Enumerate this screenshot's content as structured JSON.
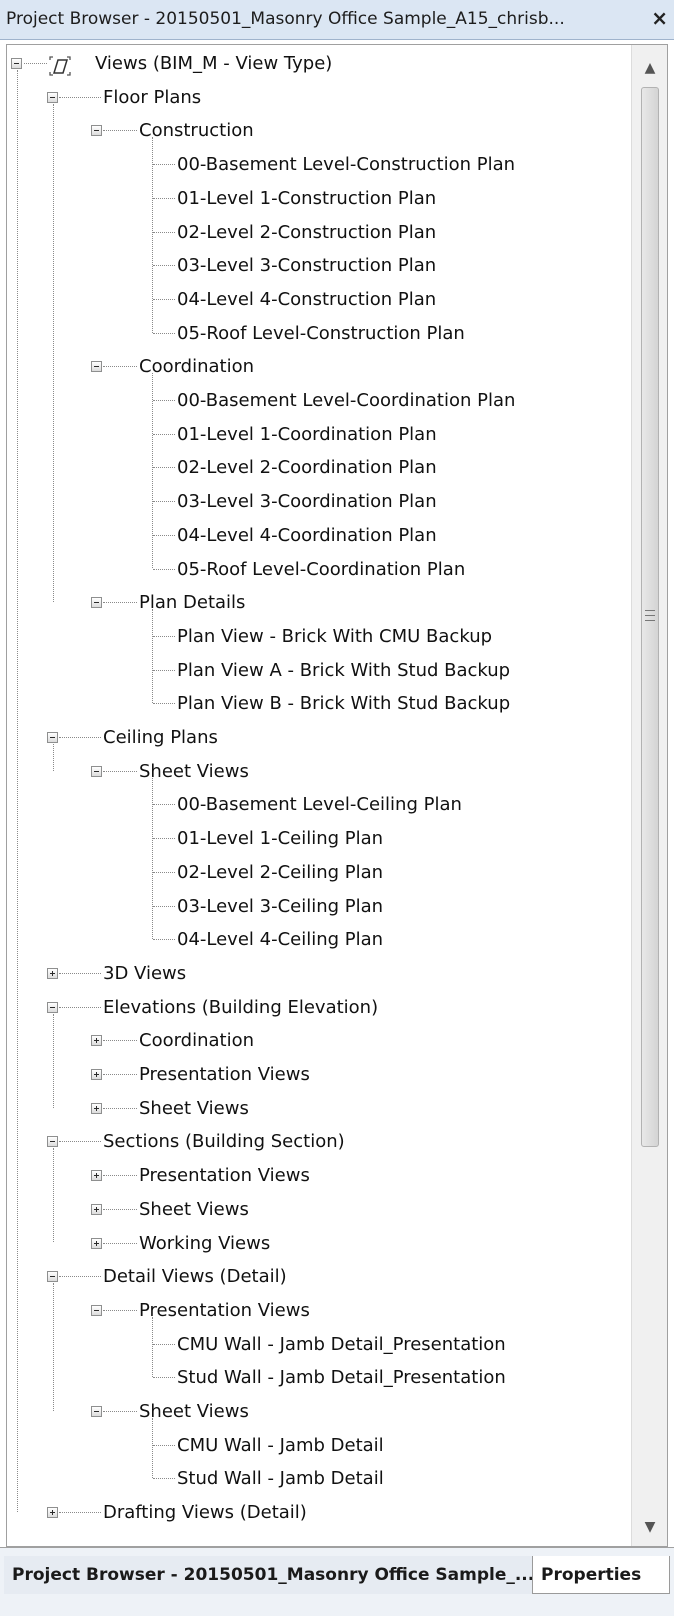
{
  "title_bar": {
    "title": "Project Browser - 20150501_Masonry Office Sample_A15_chrisb...",
    "close_label": "×"
  },
  "tree": {
    "items": [
      {
        "label": "Views (BIM_M - View Type)",
        "level": 0,
        "state": "expanded",
        "root": true
      },
      {
        "label": "Floor Plans",
        "level": 1,
        "state": "expanded"
      },
      {
        "label": "Construction",
        "level": 2,
        "state": "expanded"
      },
      {
        "label": "00-Basement Level-Construction Plan",
        "level": 3,
        "state": "leaf"
      },
      {
        "label": "01-Level 1-Construction Plan",
        "level": 3,
        "state": "leaf"
      },
      {
        "label": "02-Level 2-Construction Plan",
        "level": 3,
        "state": "leaf"
      },
      {
        "label": "03-Level 3-Construction Plan",
        "level": 3,
        "state": "leaf"
      },
      {
        "label": "04-Level 4-Construction Plan",
        "level": 3,
        "state": "leaf"
      },
      {
        "label": "05-Roof Level-Construction Plan",
        "level": 3,
        "state": "leaf"
      },
      {
        "label": "Coordination",
        "level": 2,
        "state": "expanded"
      },
      {
        "label": "00-Basement Level-Coordination Plan",
        "level": 3,
        "state": "leaf"
      },
      {
        "label": "01-Level 1-Coordination Plan",
        "level": 3,
        "state": "leaf"
      },
      {
        "label": "02-Level 2-Coordination Plan",
        "level": 3,
        "state": "leaf"
      },
      {
        "label": "03-Level 3-Coordination Plan",
        "level": 3,
        "state": "leaf"
      },
      {
        "label": "04-Level 4-Coordination Plan",
        "level": 3,
        "state": "leaf"
      },
      {
        "label": "05-Roof Level-Coordination Plan",
        "level": 3,
        "state": "leaf"
      },
      {
        "label": "Plan Details",
        "level": 2,
        "state": "expanded"
      },
      {
        "label": "Plan View - Brick With CMU Backup",
        "level": 3,
        "state": "leaf"
      },
      {
        "label": "Plan View A - Brick With Stud Backup",
        "level": 3,
        "state": "leaf"
      },
      {
        "label": "Plan View B - Brick With Stud Backup",
        "level": 3,
        "state": "leaf"
      },
      {
        "label": "Ceiling Plans",
        "level": 1,
        "state": "expanded"
      },
      {
        "label": "Sheet Views",
        "level": 2,
        "state": "expanded"
      },
      {
        "label": "00-Basement Level-Ceiling Plan",
        "level": 3,
        "state": "leaf"
      },
      {
        "label": "01-Level 1-Ceiling Plan",
        "level": 3,
        "state": "leaf"
      },
      {
        "label": "02-Level 2-Ceiling Plan",
        "level": 3,
        "state": "leaf"
      },
      {
        "label": "03-Level 3-Ceiling Plan",
        "level": 3,
        "state": "leaf"
      },
      {
        "label": "04-Level 4-Ceiling Plan",
        "level": 3,
        "state": "leaf"
      },
      {
        "label": "3D Views",
        "level": 1,
        "state": "collapsed"
      },
      {
        "label": "Elevations (Building Elevation)",
        "level": 1,
        "state": "expanded"
      },
      {
        "label": "Coordination",
        "level": 2,
        "state": "collapsed"
      },
      {
        "label": "Presentation Views",
        "level": 2,
        "state": "collapsed"
      },
      {
        "label": "Sheet Views",
        "level": 2,
        "state": "collapsed"
      },
      {
        "label": "Sections (Building Section)",
        "level": 1,
        "state": "expanded"
      },
      {
        "label": "Presentation Views",
        "level": 2,
        "state": "collapsed"
      },
      {
        "label": "Sheet Views",
        "level": 2,
        "state": "collapsed"
      },
      {
        "label": "Working Views",
        "level": 2,
        "state": "collapsed"
      },
      {
        "label": "Detail Views (Detail)",
        "level": 1,
        "state": "expanded"
      },
      {
        "label": "Presentation Views",
        "level": 2,
        "state": "expanded"
      },
      {
        "label": "CMU Wall - Jamb Detail_Presentation",
        "level": 3,
        "state": "leaf"
      },
      {
        "label": "Stud Wall - Jamb Detail_Presentation",
        "level": 3,
        "state": "leaf"
      },
      {
        "label": "Sheet Views",
        "level": 2,
        "state": "expanded"
      },
      {
        "label": "CMU Wall - Jamb Detail",
        "level": 3,
        "state": "leaf"
      },
      {
        "label": "Stud Wall - Jamb Detail",
        "level": 3,
        "state": "leaf"
      },
      {
        "label": "Drafting Views (Detail)",
        "level": 1,
        "state": "collapsed"
      }
    ]
  },
  "scrollbar": {
    "up_arrow_icon": "scroll-up-arrow-icon",
    "down_arrow_icon": "scroll-down-arrow-icon"
  },
  "tabs": {
    "project_browser": "Project Browser - 20150501_Masonry Office Sample_...",
    "properties": "Properties"
  }
}
